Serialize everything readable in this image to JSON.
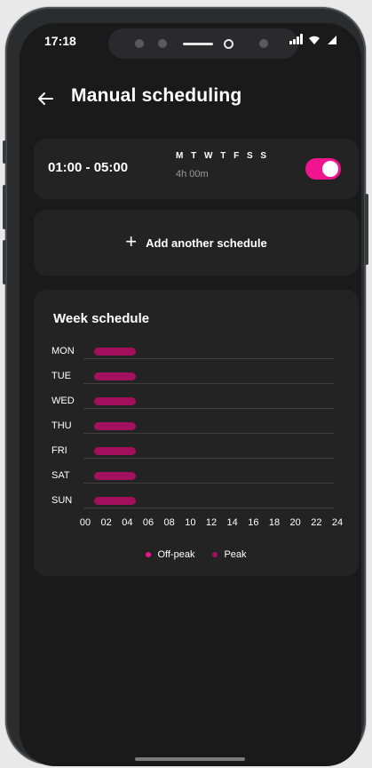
{
  "status_bar": {
    "time": "17:18"
  },
  "header": {
    "back_icon": "arrow-left-icon",
    "title": "Manual scheduling"
  },
  "schedule": {
    "time_range": "01:00 - 05:00",
    "days": "M T W T F S S",
    "duration": "4h 00m",
    "enabled": true
  },
  "add_schedule": {
    "label": "Add another schedule",
    "icon": "plus-icon"
  },
  "week_schedule": {
    "title": "Week schedule",
    "days": [
      {
        "label": "MON",
        "start": 1,
        "end": 5
      },
      {
        "label": "TUE",
        "start": 1,
        "end": 5
      },
      {
        "label": "WED",
        "start": 1,
        "end": 5
      },
      {
        "label": "THU",
        "start": 1,
        "end": 5
      },
      {
        "label": "FRI",
        "start": 1,
        "end": 5
      },
      {
        "label": "SAT",
        "start": 1,
        "end": 5
      },
      {
        "label": "SUN",
        "start": 1,
        "end": 5
      }
    ],
    "x_ticks": [
      "00",
      "02",
      "04",
      "06",
      "08",
      "10",
      "12",
      "14",
      "16",
      "18",
      "20",
      "22",
      "24"
    ],
    "legend": [
      {
        "label": "Off-peak",
        "color": "#f0158f"
      },
      {
        "label": "Peak",
        "color": "#a3105e"
      }
    ]
  },
  "colors": {
    "accent": "#f0158f",
    "peak": "#a3105e",
    "background": "#1a1a1b",
    "card": "#232324"
  }
}
